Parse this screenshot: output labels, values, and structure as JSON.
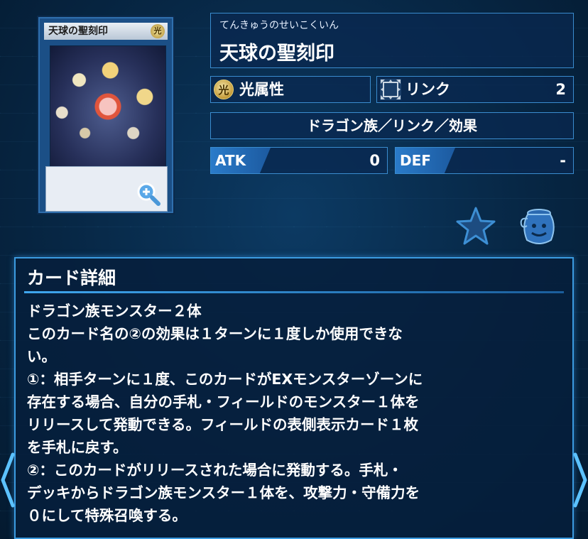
{
  "card": {
    "name_on_art": "天球の聖刻印",
    "attr_glyph": "光"
  },
  "ruby": "てんきゅうのせいこくいん",
  "name": "天球の聖刻印",
  "attribute": {
    "glyph": "光",
    "label": "光属性"
  },
  "link": {
    "label": "リンク",
    "value": "2"
  },
  "type_line": "ドラゴン族／リンク／効果",
  "atk": {
    "label": "ATK",
    "value": "0"
  },
  "def": {
    "label": "DEF",
    "value": "-"
  },
  "icons": {
    "zoom": "zoom-in-icon",
    "favorite": "star-icon",
    "deck": "pot-icon",
    "prev": "chevron-left-icon",
    "next": "chevron-right-icon"
  },
  "detail": {
    "title": "カード詳細",
    "text": "ドラゴン族モンスター２体\nこのカード名の②の効果は１ターンに１度しか使用できな\nい。\n①：相手ターンに１度、このカードがEXモンスターゾーンに\n存在する場合、自分の手札・フィールドのモンスター１体を\nリリースして発動できる。フィールドの表側表示カード１枚\nを手札に戻す。\n②：このカードがリリースされた場合に発動する。手札・\nデッキからドラゴン族モンスター１体を、攻撃力・守備力を\n０にして特殊召喚する。"
  },
  "colors": {
    "accent": "#3b9be0",
    "panel": "#0a2850",
    "attr_gold": "#c49b38"
  }
}
